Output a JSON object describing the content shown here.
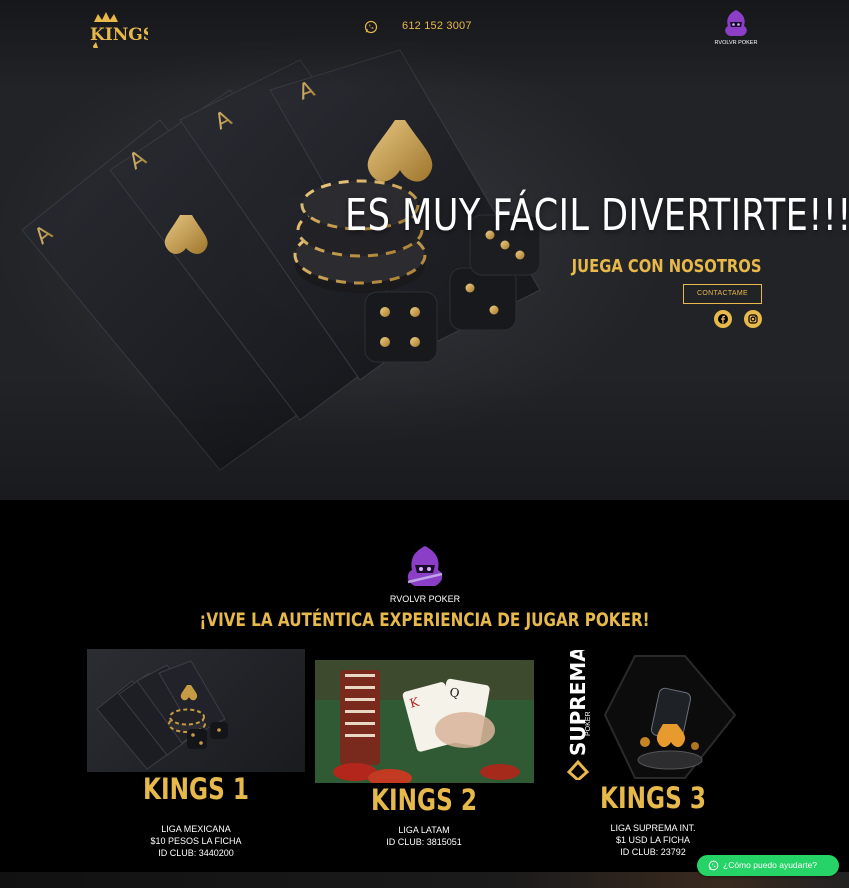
{
  "header": {
    "logo_text": "KINGS",
    "phone": "612 152 3007",
    "partner_logo_text": "RVOLVR POKER",
    "whatsapp_icon": "whatsapp-icon"
  },
  "hero": {
    "headline": "ES MUY FÁCIL DIVERTIRTE!!!",
    "subheadline": "JUEGA CON NOSOTROS",
    "cta_label": "CONTACTAME",
    "social": [
      {
        "icon": "facebook-icon"
      },
      {
        "icon": "instagram-icon"
      }
    ]
  },
  "section": {
    "logo_text": "RVOLVR POKER",
    "tagline": "¡VIVE LA AUTÉNTICA EXPERIENCIA DE JUGAR POKER!",
    "clubs": [
      {
        "title": "KINGS 1",
        "lines": [
          "LIGA MEXICANA",
          "$10 PESOS LA FICHA",
          "ID CLUB: 3440200"
        ]
      },
      {
        "title": "KINGS 2",
        "lines": [
          "LIGA LATAM",
          "ID CLUB: 3815051"
        ]
      },
      {
        "title": "KINGS 3",
        "lines": [
          "LIGA SUPREMA INT.",
          "$1 USD LA FICHA",
          "ID CLUB: 23792"
        ],
        "image_text": {
          "brand": "SUPREMA",
          "sub": "POKER"
        }
      }
    ]
  },
  "chat_widget": {
    "label": "¿Cómo puedo ayudarte?"
  },
  "colors": {
    "accent_gold": "#e7b84a",
    "background": "#000000",
    "whatsapp_green": "#25d366"
  }
}
